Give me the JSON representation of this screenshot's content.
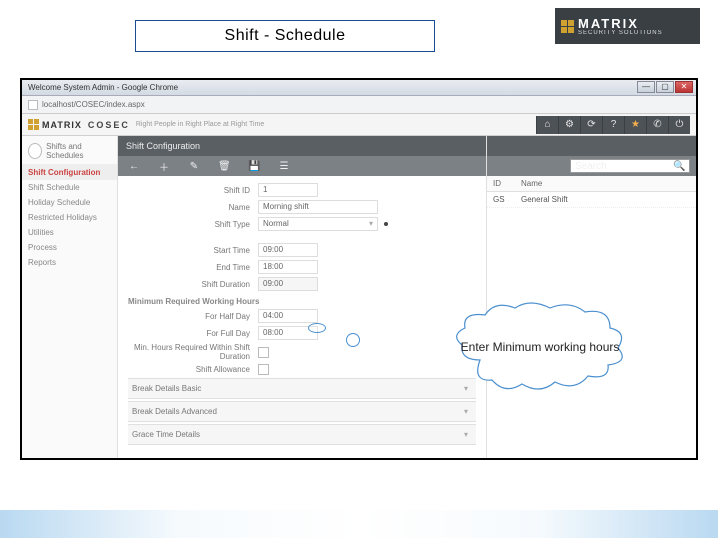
{
  "slide_title": "Shift - Schedule",
  "brand": {
    "name": "MATRIX",
    "sub": "SECURITY SOLUTIONS"
  },
  "browser": {
    "window_title": "Welcome System Admin - Google Chrome",
    "url": "localhost/COSEC/index.aspx"
  },
  "app": {
    "product": "COSEC",
    "tagline": "Right People in Right Place at Right Time",
    "top_icons": [
      "home",
      "gear",
      "refresh",
      "help",
      "star",
      "phone",
      "power"
    ]
  },
  "sidebar": {
    "module": "Shifts and Schedules",
    "items": [
      {
        "label": "Shift Configuration",
        "active": true
      },
      {
        "label": "Shift Schedule"
      },
      {
        "label": "Holiday Schedule"
      },
      {
        "label": "Restricted Holidays"
      },
      {
        "label": "Utilities"
      },
      {
        "label": "Process"
      },
      {
        "label": "Reports"
      }
    ]
  },
  "form": {
    "header": "Shift Configuration",
    "tools": [
      "back",
      "add",
      "edit",
      "delete",
      "save",
      "list"
    ],
    "fields": {
      "shift_id_label": "Shift ID",
      "shift_id": "1",
      "name_label": "Name",
      "name": "Morning shift",
      "shift_type_label": "Shift Type",
      "shift_type": "Normal",
      "start_time_label": "Start Time",
      "start_time": "09:00",
      "end_time_label": "End Time",
      "end_time": "18:00",
      "shift_duration_label": "Shift Duration",
      "shift_duration": "09:00",
      "section_min": "Minimum Required Working Hours",
      "half_day_label": "For Half Day",
      "half_day": "04:00",
      "full_day_label": "For Full Day",
      "full_day": "08:00",
      "min_within_label": "Min. Hours Required Within Shift Duration",
      "shift_allowance_label": "Shift Allowance"
    },
    "accordions": [
      "Break Details Basic",
      "Break Details Advanced",
      "Grace Time Details"
    ]
  },
  "right": {
    "search_placeholder": "Search",
    "cols": [
      "ID",
      "Name"
    ],
    "rows": [
      {
        "id": "GS",
        "name": "General Shift"
      }
    ]
  },
  "callout": "Enter Minimum working hours"
}
